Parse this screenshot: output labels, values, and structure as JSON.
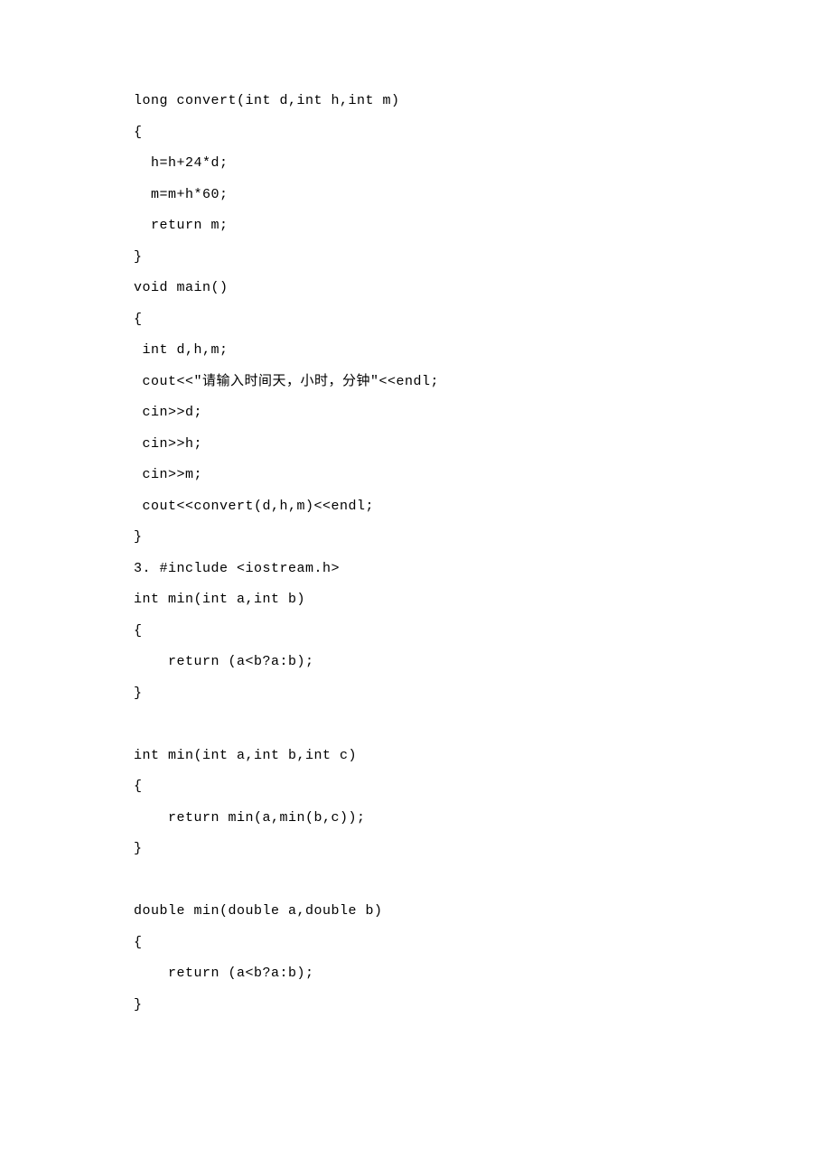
{
  "code": {
    "lines": [
      "long convert(int d,int h,int m)",
      "{",
      "  h=h+24*d;",
      "  m=m+h*60;",
      "  return m;",
      "}",
      "void main()",
      "{",
      " int d,h,m;",
      " cout<<\"请输入时间天，小时，分钟\"<<endl;",
      " cin>>d;",
      " cin>>h;",
      " cin>>m;",
      " cout<<convert(d,h,m)<<endl;",
      "}",
      "3. #include <iostream.h>",
      "int min(int a,int b)",
      "{",
      "    return (a<b?a:b);",
      "}",
      "",
      "int min(int a,int b,int c)",
      "{",
      "    return min(a,min(b,c));",
      "}",
      "",
      "double min(double a,double b)",
      "{",
      "    return (a<b?a:b);",
      "}"
    ]
  }
}
